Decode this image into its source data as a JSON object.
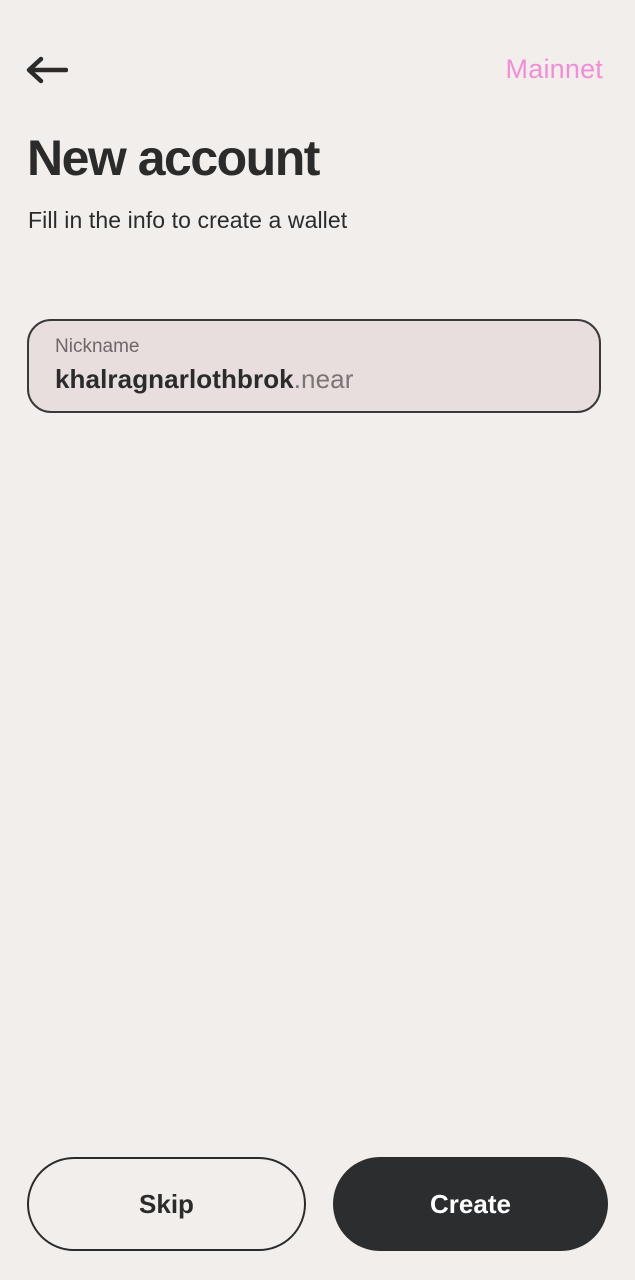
{
  "header": {
    "back_icon": "arrow-left-icon",
    "network_label": "Mainnet",
    "network_color": "#f08ed6"
  },
  "page": {
    "title": "New account",
    "subtitle": "Fill in the info to create a wallet"
  },
  "nickname_field": {
    "label": "Nickname",
    "value": "khalragnarlothbrok",
    "suffix": ".near"
  },
  "actions": {
    "skip_label": "Skip",
    "create_label": "Create"
  },
  "colors": {
    "background": "#f2eeeb",
    "field_background": "#e8dedd",
    "primary_button": "#2b2d2e",
    "text": "#2b2b2b"
  }
}
